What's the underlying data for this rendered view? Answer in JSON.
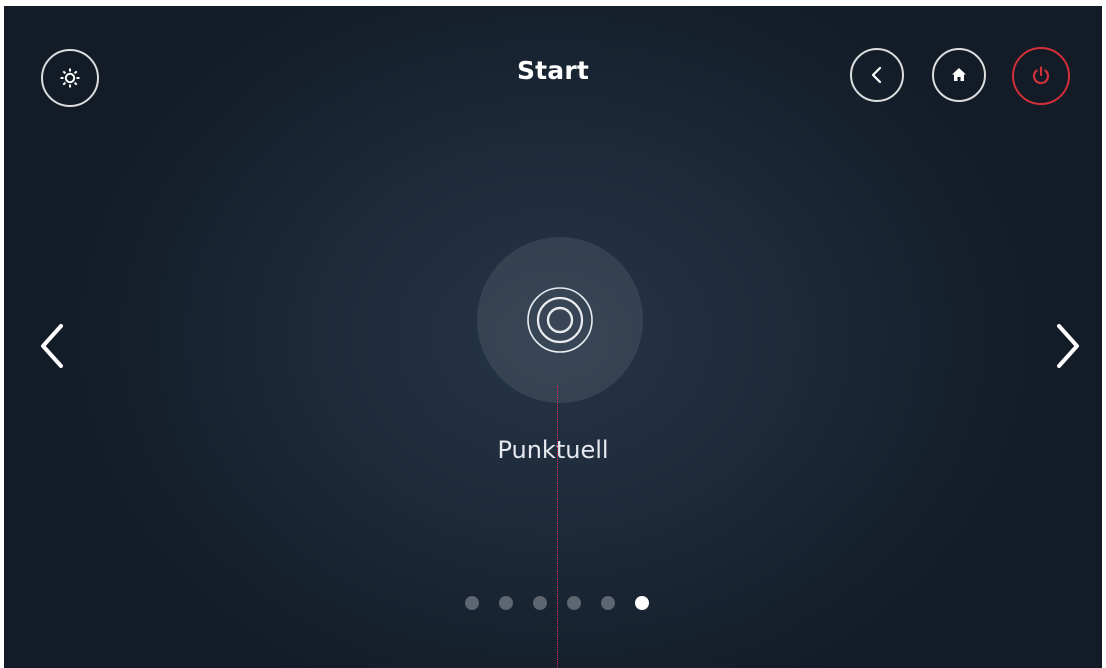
{
  "header": {
    "title": "Start",
    "settings_icon": "gear-icon",
    "back_icon": "chevron-left-icon",
    "home_icon": "home-icon",
    "power_icon": "power-icon",
    "power_color": "#d2303a"
  },
  "carousel": {
    "mode_icon": "target-rings-icon",
    "mode_label": "Punktuell",
    "prev_icon": "chevron-left-icon",
    "next_icon": "chevron-right-icon",
    "page_count": 6,
    "active_page": 6
  },
  "colors": {
    "background": "#1d2a3a",
    "accent_red": "#d2303a",
    "guide_line": "#e0245e"
  }
}
